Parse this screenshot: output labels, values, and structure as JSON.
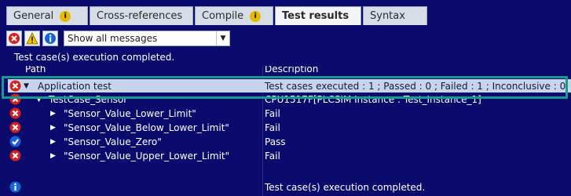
{
  "tabs": [
    {
      "label": "General",
      "info": true,
      "active": false
    },
    {
      "label": "Cross-references",
      "info": false,
      "active": false
    },
    {
      "label": "Compile",
      "info": true,
      "active": false
    },
    {
      "label": "Test results",
      "info": false,
      "active": true
    },
    {
      "label": "Syntax",
      "info": false,
      "active": false
    }
  ],
  "tab_info_icon": "i",
  "toolbar": {
    "filter": {
      "selected": "Show all messages"
    }
  },
  "status_text": "Test case(s) execution completed.",
  "columns": {
    "path": "Path",
    "description": "Description"
  },
  "rows": [
    {
      "icon": "error",
      "expand": "expanded",
      "indent": 0,
      "name": "Application test",
      "description": "Test cases executed : 1 ; Passed : 0 ; Failed : 1 ; Inconclusive : 0",
      "selected": true
    },
    {
      "icon": "error",
      "expand": "expanded",
      "indent": 1,
      "name": "TestCase_Sensor",
      "description": "CPU1517F[PLCSIM Instance : Test_Instance_1]",
      "selected": false
    },
    {
      "icon": "error",
      "expand": "collapsed",
      "indent": 2,
      "name": "\"Sensor_Value_Lower_Limit\"",
      "description": "Fail",
      "selected": false
    },
    {
      "icon": "error",
      "expand": "collapsed",
      "indent": 2,
      "name": "\"Sensor_Value_Below_Lower_Limit\"",
      "description": "Fail",
      "selected": false
    },
    {
      "icon": "pass",
      "expand": "collapsed",
      "indent": 2,
      "name": "\"Sensor_Value_Zero\"",
      "description": "Pass",
      "selected": false
    },
    {
      "icon": "error",
      "expand": "collapsed",
      "indent": 2,
      "name": "\"Sensor_Value_Upper_Lower_Limit\"",
      "description": "Fail",
      "selected": false
    },
    {
      "icon": "info",
      "expand": "none",
      "indent": 0,
      "name": "",
      "description": "Test case(s) execution completed.",
      "selected": false
    }
  ]
}
